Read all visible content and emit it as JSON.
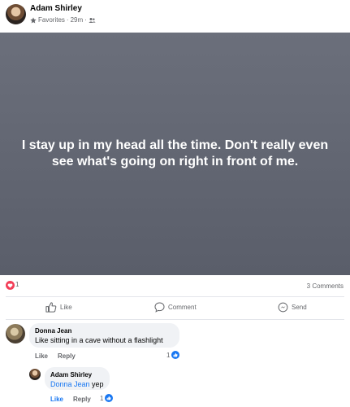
{
  "post": {
    "author": "Adam Shirley",
    "audience": "Favorites",
    "time": "29m",
    "text": "I stay up in my head all the time. Don't really even see what's going on right in front of me."
  },
  "stats": {
    "reactions": "1",
    "comments": "3 Comments"
  },
  "actions": {
    "like": "Like",
    "comment": "Comment",
    "send": "Send"
  },
  "comments": [
    {
      "author": "Donna Jean",
      "text": "Like sitting in a cave without a flashlight",
      "like_label": "Like",
      "reply_label": "Reply",
      "reactions": "1"
    },
    {
      "author": "Adam Shirley",
      "mention": "Donna Jean",
      "text": " yep",
      "like_label": "Like",
      "reply_label": "Reply",
      "reactions": "1"
    }
  ],
  "colors": {
    "post_background": "#5f636f",
    "accent": "#1877f2",
    "love": "#f33e58"
  }
}
